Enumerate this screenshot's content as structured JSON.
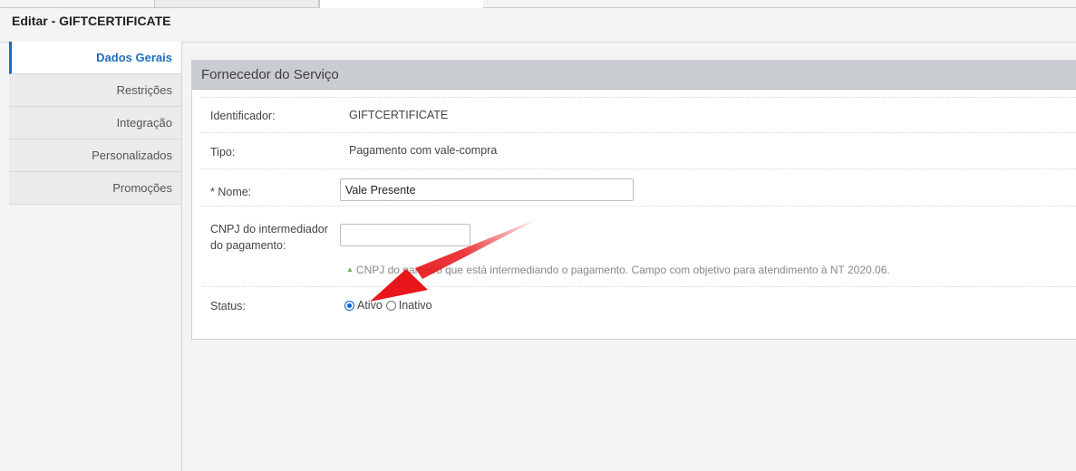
{
  "page": {
    "title": "Editar - GIFTCERTIFICATE"
  },
  "sidebar": {
    "items": [
      {
        "label": "Dados Gerais"
      },
      {
        "label": "Restrições"
      },
      {
        "label": "Integração"
      },
      {
        "label": "Personalizados"
      },
      {
        "label": "Promoções"
      }
    ],
    "active_index": 0
  },
  "panel": {
    "title": "Fornecedor do Serviço",
    "fields": {
      "identificador": {
        "label": "Identificador:",
        "value": "GIFTCERTIFICATE"
      },
      "tipo": {
        "label": "Tipo:",
        "value": "Pagamento com vale-compra"
      },
      "nome": {
        "label": "* Nome:",
        "value": "Vale Presente"
      },
      "cnpj": {
        "label_line1": "CNPJ do intermediador",
        "label_line2": "do pagamento:",
        "value": "",
        "hint": "CNPJ do parceiro que está intermediando o pagamento. Campo com objetivo para atendimento à NT 2020.06."
      },
      "status": {
        "label": "Status:",
        "options": [
          "Ativo",
          "Inativo"
        ],
        "selected": "Ativo"
      }
    }
  },
  "annotation": {
    "color": "#e8161b"
  },
  "colors": {
    "accent": "#1a6fbf",
    "header_bg": "#c9cdd1"
  }
}
